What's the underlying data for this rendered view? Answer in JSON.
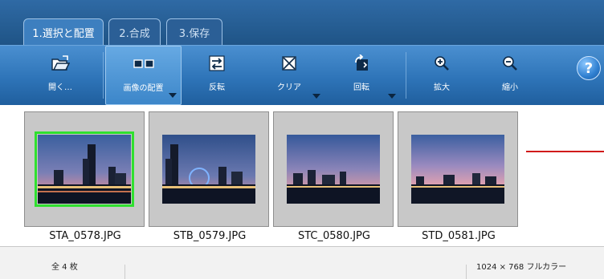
{
  "tabs": [
    {
      "label": "1.選択と配置",
      "active": true
    },
    {
      "label": "2.合成",
      "active": false
    },
    {
      "label": "3.保存",
      "active": false
    }
  ],
  "toolbar": {
    "open": "開く…",
    "arrange": "画像の配置",
    "flip": "反転",
    "clear": "クリア",
    "rotate": "回転",
    "zoom_in": "拡大",
    "zoom_out": "縮小",
    "help": "?"
  },
  "thumbnails": [
    {
      "filename": "STA_0578.JPG",
      "selected": true
    },
    {
      "filename": "STB_0579.JPG",
      "selected": false
    },
    {
      "filename": "STC_0580.JPG",
      "selected": false
    },
    {
      "filename": "STD_0581.JPG",
      "selected": false
    }
  ],
  "status": {
    "count": "全 4 枚",
    "resolution": "1024 × 768 フルカラー"
  },
  "colors": {
    "accent": "#3d7fbf",
    "selection": "#2fe02f",
    "line": "#d11a1a"
  }
}
